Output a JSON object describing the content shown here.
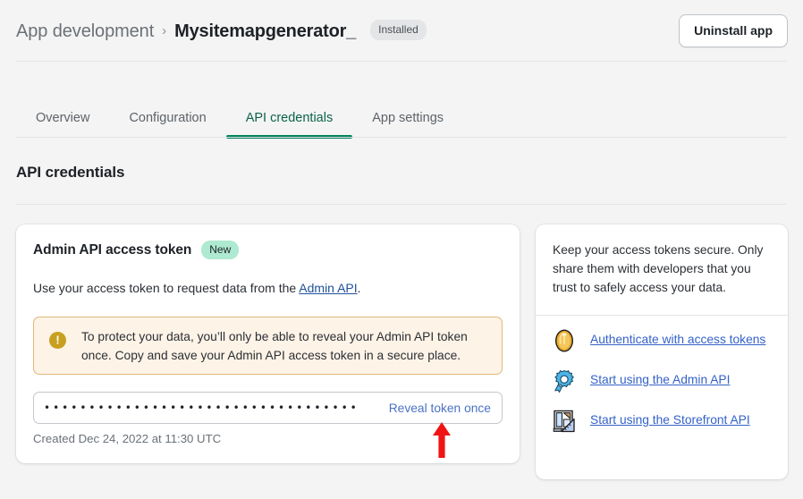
{
  "header": {
    "breadcrumb_parent": "App development",
    "breadcrumb_separator": "›",
    "breadcrumb_current": "Mysitemapgenerator_",
    "installed_badge": "Installed",
    "uninstall_label": "Uninstall app"
  },
  "tabs": [
    {
      "label": "Overview",
      "active": false
    },
    {
      "label": "Configuration",
      "active": false
    },
    {
      "label": "API credentials",
      "active": true
    },
    {
      "label": "App settings",
      "active": false
    }
  ],
  "page": {
    "title": "API credentials"
  },
  "token_card": {
    "title": "Admin API access token",
    "badge": "New",
    "description_prefix": "Use your access token to request data from the ",
    "description_link": "Admin API",
    "description_suffix": ".",
    "warning_icon": "exclamation-circle-icon",
    "warning_text": "To protect your data, you’ll only be able to reveal your Admin API token once. Copy and save your Admin API access token in a secure place.",
    "masked_token": "•••••••••••••••••••••••••••••••••••",
    "reveal_label": "Reveal token once",
    "created_text": "Created Dec 24, 2022 at 11:30 UTC"
  },
  "side_card": {
    "note": "Keep your access tokens secure. Only share them with developers that you trust to safely access your data.",
    "links": [
      {
        "icon": "access-token-coin-icon",
        "label": "Authenticate with access tokens"
      },
      {
        "icon": "gear-icon",
        "label": "Start using the Admin API"
      },
      {
        "icon": "storefront-document-icon",
        "label": "Start using the Storefront API"
      }
    ]
  },
  "annotation": {
    "arrow": "red-up-arrow",
    "color": "#f01414"
  },
  "colors": {
    "page_background": "#f4f4f4",
    "card_background": "#ffffff",
    "accent_tab": "#00805a",
    "link": "#3462c8",
    "warning_background": "#fdf3e7",
    "warning_border": "#e0b878",
    "warning_icon": "#c8a020",
    "badge_new": "#aee9d1",
    "badge_installed": "#e4e5e7"
  }
}
